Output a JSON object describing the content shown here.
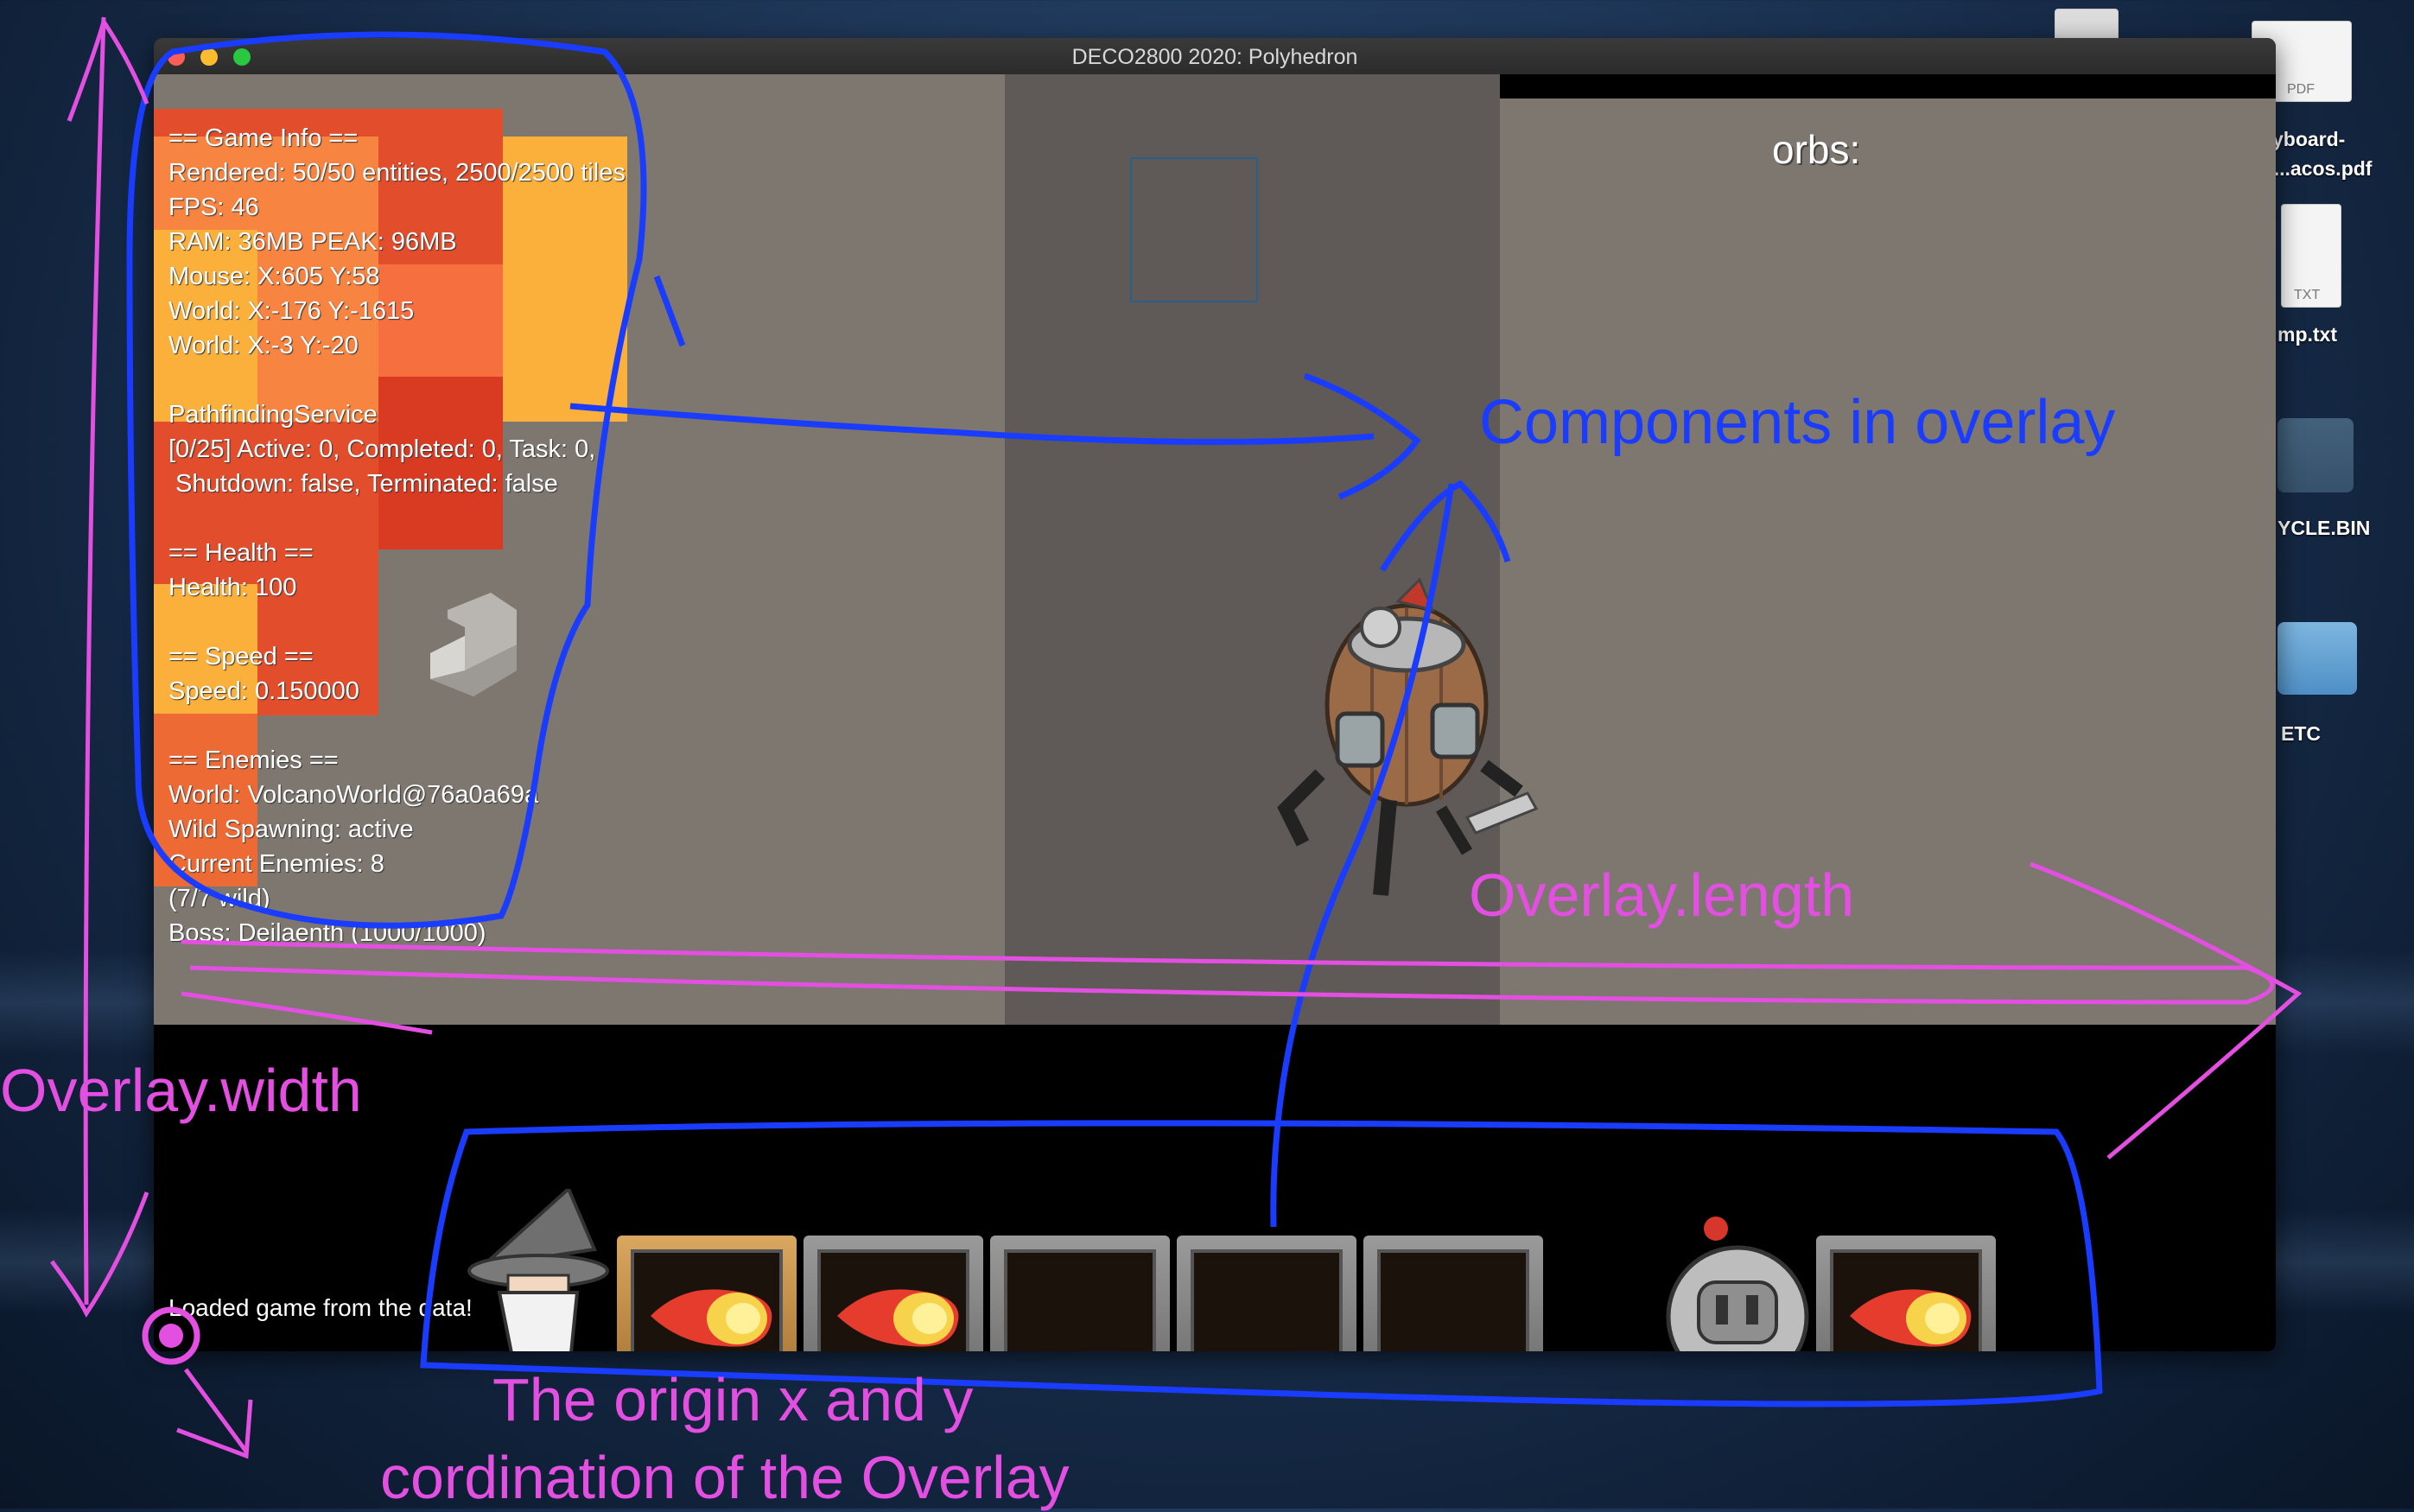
{
  "window": {
    "title": "DECO2800 2020: Polyhedron"
  },
  "debug": {
    "lines": [
      "== Game Info ==",
      "Rendered: 50/50 entities, 2500/2500 tiles",
      "FPS: 46",
      "RAM: 36MB PEAK: 96MB",
      "Mouse: X:605 Y:58",
      "World: X:-176 Y:-1615",
      "World: X:-3 Y:-20",
      "",
      "PathfindingService",
      "[0/25] Active: 0, Completed: 0, Task: 0,",
      " Shutdown: false, Terminated: false",
      "",
      "== Health ==",
      "Health: 100",
      "",
      "== Speed ==",
      "Speed: 0.150000",
      "",
      "== Enemies ==",
      "World: VolcanoWorld@76a0a69a",
      "Wild Spawning: active",
      "Current Enemies: 8",
      "(7/7 wild)",
      "Boss: Deilaenth (1000/1000)"
    ]
  },
  "hud": {
    "orbs_label": "orbs:",
    "status_message": "Loaded game from the data!",
    "selected_slot": 0
  },
  "annotations": {
    "components": "Components in overlay",
    "length": "Overlay.length",
    "width": "Overlay.width",
    "origin_line1": "The origin x and y",
    "origin_line2": "cordination of the Overlay"
  },
  "desktop": {
    "icons": [
      {
        "label_line1": "yboard-",
        "label_line2": "nt...acos.pdf",
        "badge": "PDF"
      },
      {
        "label": "mp.txt",
        "badge": "TXT"
      },
      {
        "label": "YCLE.BIN"
      },
      {
        "label": "ETC"
      }
    ]
  },
  "colors": {
    "annotation_blue": "#1a3cff",
    "annotation_pink": "#e34fe0"
  }
}
